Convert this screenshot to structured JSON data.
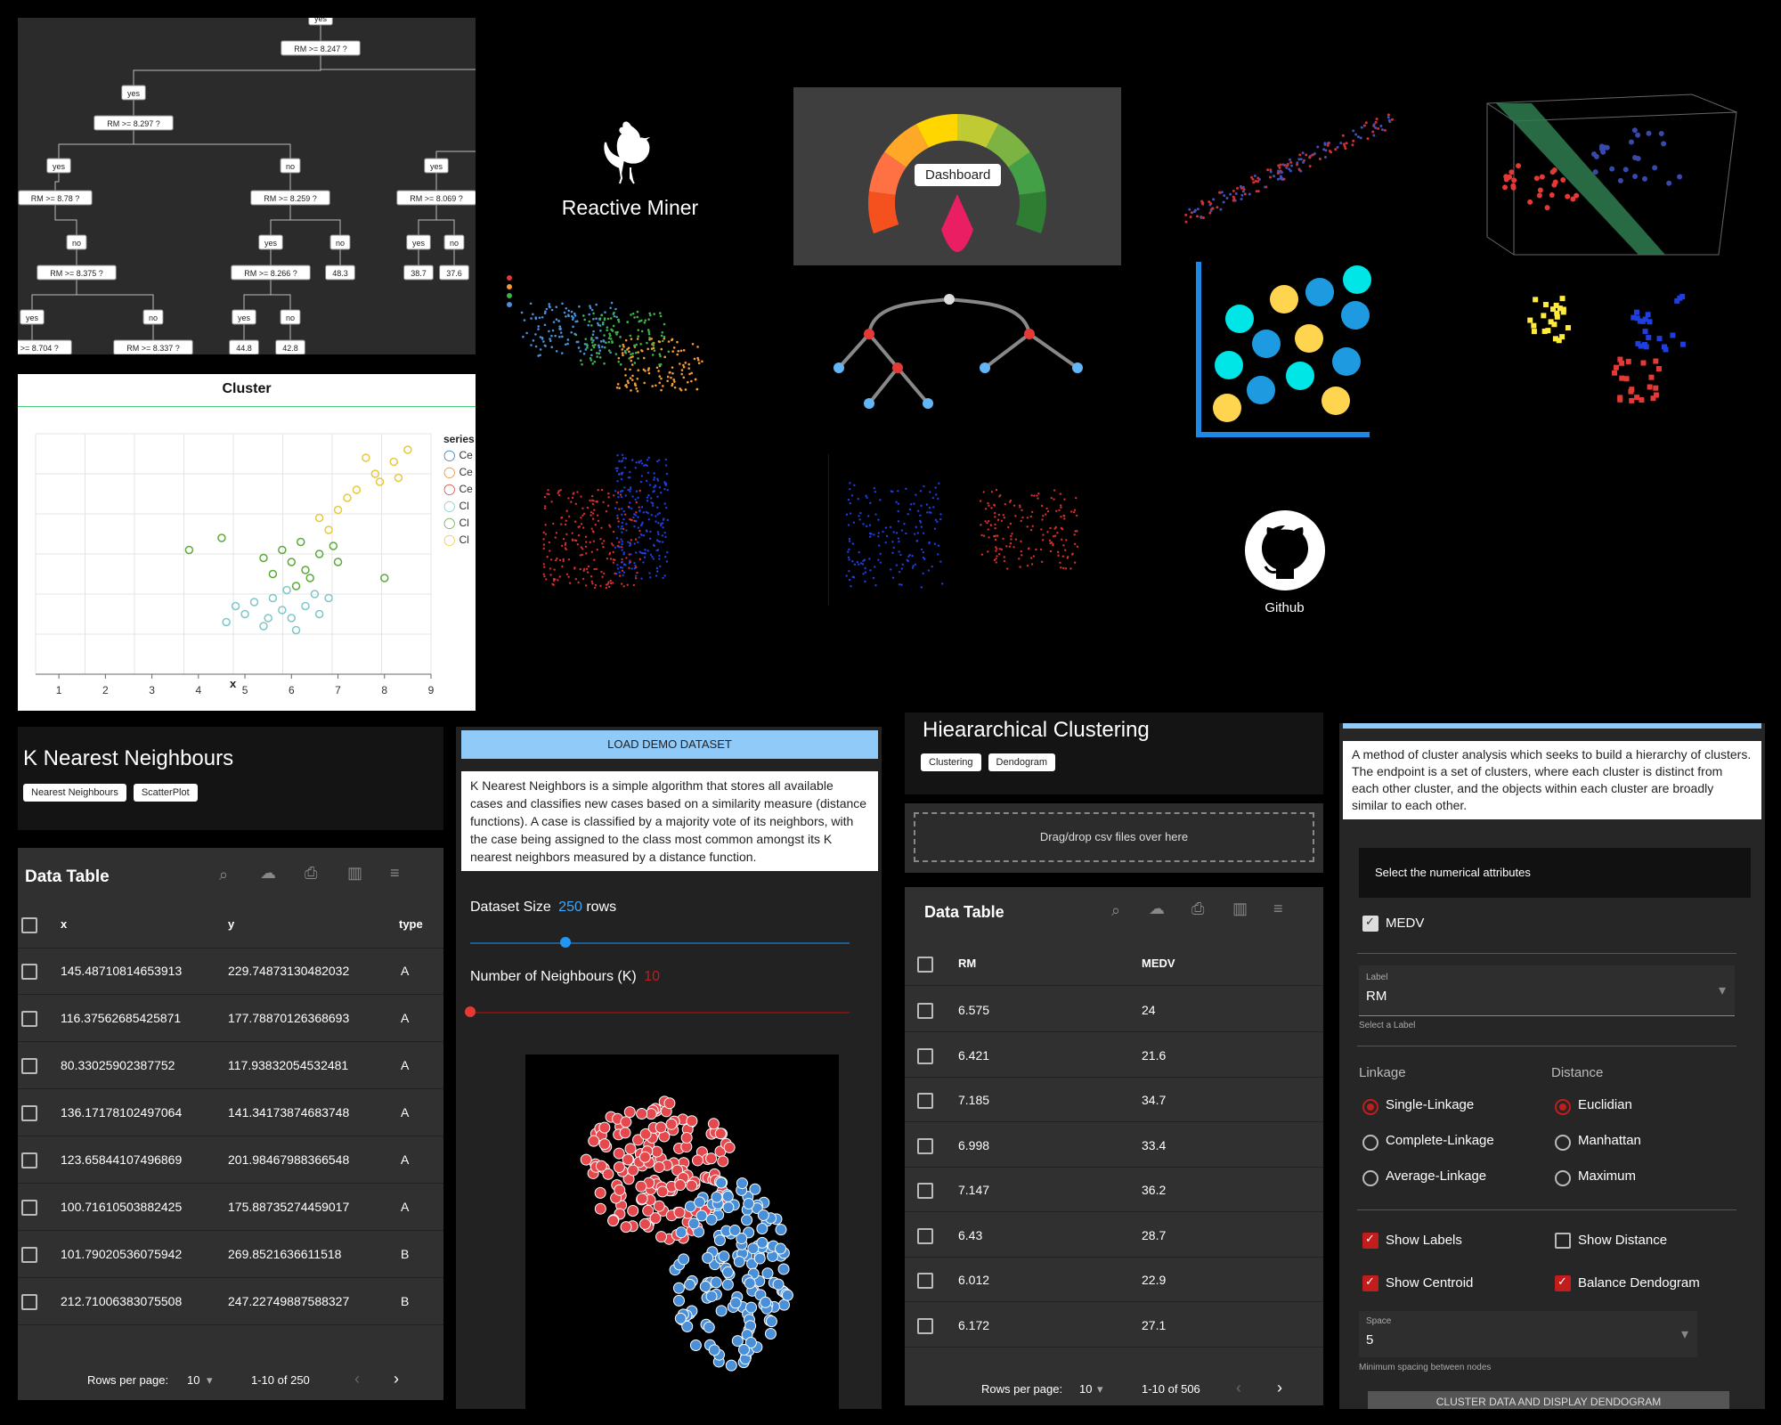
{
  "tree": {
    "nodes": [
      "yes",
      "RM >= 8.247 ?",
      "yes",
      "RM >= 8.297 ?",
      "yes",
      "no",
      "yes",
      "RM >= 8.78 ?",
      "RM >= 8.259 ?",
      "RM >= 8.069 ?",
      "no",
      "yes",
      "no",
      "yes",
      "no",
      "RM >= 8.375 ?",
      "RM >= 8.266 ?",
      "48.3",
      "38.7",
      "37.6",
      "yes",
      "no",
      "yes",
      "no",
      "RM >= 8.704 ?",
      "RM >= 8.337 ?",
      "44.8",
      "42.8"
    ]
  },
  "cluster_chart": {
    "title": "Cluster",
    "xlabel": "x",
    "legend_title": "series",
    "legend_items": [
      "Ce",
      "Ce",
      "Ce",
      "Cl",
      "Cl",
      "Cl"
    ],
    "x_ticks": [
      "1",
      "2",
      "3",
      "4",
      "5",
      "6",
      "7",
      "8",
      "9"
    ]
  },
  "chart_data": {
    "type": "scatter",
    "title": "Cluster",
    "xlabel": "x",
    "ylabel": "",
    "xlim": [
      0.5,
      9
    ],
    "legend_position": "right",
    "series": [
      {
        "color": "#7ec7c6",
        "points": [
          [
            4.6,
            1.3
          ],
          [
            5.0,
            1.5
          ],
          [
            5.4,
            1.2
          ],
          [
            5.8,
            1.6
          ],
          [
            6.0,
            1.4
          ],
          [
            6.3,
            1.7
          ],
          [
            5.6,
            1.9
          ],
          [
            6.6,
            1.5
          ],
          [
            5.2,
            1.8
          ],
          [
            6.8,
            1.9
          ],
          [
            5.9,
            2.1
          ],
          [
            4.8,
            1.7
          ],
          [
            6.1,
            1.1
          ],
          [
            5.5,
            1.4
          ],
          [
            6.5,
            2.0
          ]
        ]
      },
      {
        "color": "#5aaa3a",
        "points": [
          [
            5.6,
            2.5
          ],
          [
            6.0,
            2.8
          ],
          [
            6.3,
            2.6
          ],
          [
            6.6,
            3.0
          ],
          [
            5.8,
            3.1
          ],
          [
            6.2,
            3.3
          ],
          [
            6.9,
            3.2
          ],
          [
            5.4,
            2.9
          ],
          [
            6.4,
            2.4
          ],
          [
            7.0,
            2.8
          ],
          [
            4.5,
            3.4
          ],
          [
            3.8,
            3.1
          ],
          [
            8.0,
            2.4
          ],
          [
            6.1,
            2.2
          ]
        ]
      },
      {
        "color": "#e8c83c",
        "points": [
          [
            6.6,
            3.9
          ],
          [
            7.0,
            4.1
          ],
          [
            7.4,
            4.6
          ],
          [
            7.8,
            5.0
          ],
          [
            8.2,
            5.3
          ],
          [
            7.2,
            4.4
          ],
          [
            6.8,
            3.6
          ],
          [
            8.5,
            5.6
          ],
          [
            7.6,
            5.4
          ],
          [
            7.9,
            4.8
          ],
          [
            8.3,
            4.9
          ]
        ]
      }
    ]
  },
  "logo": {
    "label": "Reactive Miner"
  },
  "gauge": {
    "label": "Dashboard"
  },
  "github": {
    "label": "Github"
  },
  "knn": {
    "title": "K Nearest Neighbours",
    "chips": [
      "Nearest Neighbours",
      "ScatterPlot"
    ],
    "load_button": "LOAD DEMO DATASET",
    "description": "K Nearest Neighbors is a simple algorithm that stores all available cases and classifies new cases based on a similarity measure (distance functions). A case is classified by a majority vote of its neighbors, with the case being assigned to the class most common amongst its K nearest neighbors measured by a distance function.",
    "dataset_size_label": "Dataset Size",
    "dataset_size_value": "250",
    "dataset_size_unit": "rows",
    "dataset_size_fraction": 0.25,
    "neighbours_label": "Number of Neighbours (K)",
    "neighbours_value": "10",
    "neighbours_fraction": 0.0,
    "table": {
      "title": "Data Table",
      "headers": [
        "x",
        "y",
        "type"
      ],
      "rows": [
        [
          "145.48710814653913",
          "229.74873130482032",
          "A"
        ],
        [
          "116.37562685425871",
          "177.78870126368693",
          "A"
        ],
        [
          "80.33025902387752",
          "117.93832054532481",
          "A"
        ],
        [
          "136.17178102497064",
          "141.34173874683748",
          "A"
        ],
        [
          "123.65844107496869",
          "201.98467988366548",
          "A"
        ],
        [
          "100.71610503882425",
          "175.88735274459017",
          "A"
        ],
        [
          "101.79020536075942",
          "269.8521636611518",
          "B"
        ],
        [
          "212.71006383075508",
          "247.22749887588327",
          "B"
        ]
      ],
      "rows_per_page_label": "Rows per page:",
      "rows_per_page": "10",
      "range": "1-10 of 250"
    }
  },
  "hier": {
    "title": "Hieararchical Clustering",
    "chips": [
      "Clustering",
      "Dendogram"
    ],
    "dropzone": "Drag/drop csv files over here",
    "description": "A method of cluster analysis which seeks to build a hierarchy of clusters. The endpoint is a set of clusters, where each cluster is distinct from each other cluster, and the objects within each cluster are broadly similar to each other.",
    "select_attr": "Select the numerical attributes",
    "attr": "MEDV",
    "label_caption": "Label",
    "label_value": "RM",
    "label_hint": "Select a Label",
    "linkage_title": "Linkage",
    "linkage_options": [
      "Single-Linkage",
      "Complete-Linkage",
      "Average-Linkage"
    ],
    "distance_title": "Distance",
    "distance_options": [
      "Euclidian",
      "Manhattan",
      "Maximum"
    ],
    "show_labels": "Show Labels",
    "show_distance": "Show Distance",
    "show_centroid": "Show Centroid",
    "balance": "Balance Dendogram",
    "space_caption": "Space",
    "space_value": "5",
    "space_hint": "Minimum spacing between nodes",
    "cluster_button": "CLUSTER DATA AND DISPLAY DENDOGRAM",
    "table": {
      "title": "Data Table",
      "headers": [
        "RM",
        "MEDV"
      ],
      "rows": [
        [
          "6.575",
          "24"
        ],
        [
          "6.421",
          "21.6"
        ],
        [
          "7.185",
          "34.7"
        ],
        [
          "6.998",
          "33.4"
        ],
        [
          "7.147",
          "36.2"
        ],
        [
          "6.43",
          "28.7"
        ],
        [
          "6.012",
          "22.9"
        ],
        [
          "6.172",
          "27.1"
        ]
      ],
      "rows_per_page_label": "Rows per page:",
      "rows_per_page": "10",
      "range": "1-10 of 506"
    }
  },
  "colors": {
    "accent_red": "#c21d1d",
    "accent_blue": "#90caf9",
    "panel": "#303030"
  },
  "icons": [
    "search-icon",
    "cloud-download-icon",
    "print-icon",
    "columns-icon",
    "filter-icon",
    "chevron-left-icon",
    "chevron-right-icon",
    "github-icon",
    "rooster-icon"
  ]
}
